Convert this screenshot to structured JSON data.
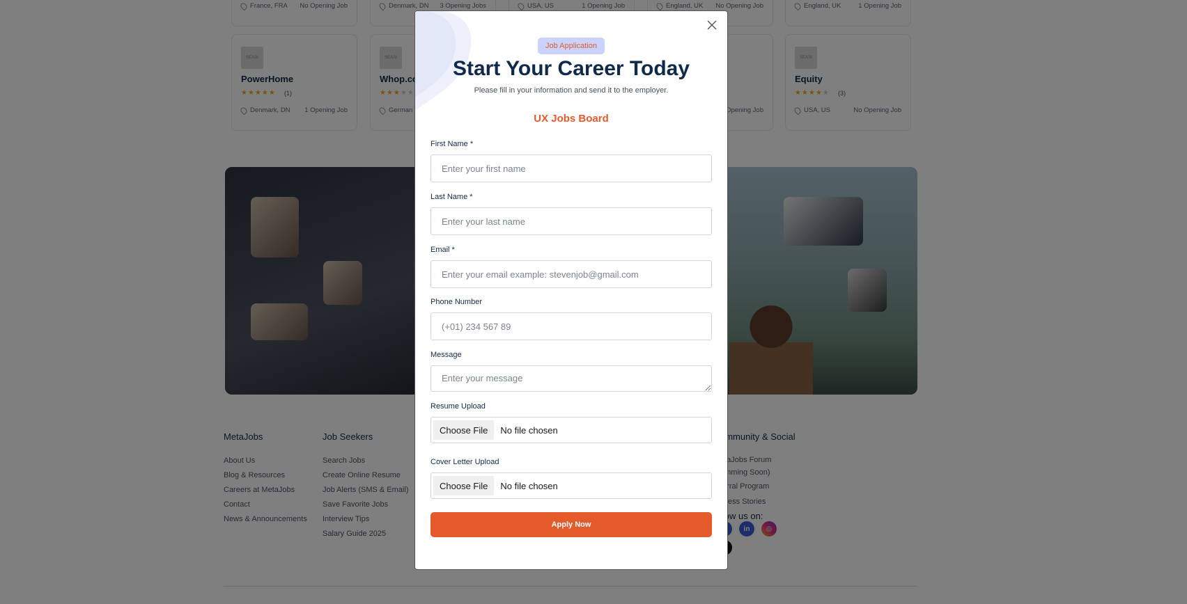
{
  "top_cards": [
    {
      "location": "France, FRA",
      "jobs": "No Opening Job"
    },
    {
      "location": "Denmark, DN",
      "jobs": "3 Opening Jobs"
    },
    {
      "location": "USA, US",
      "jobs": "1 Opening Job"
    },
    {
      "location": "England, UK",
      "jobs": "No Opening Job"
    },
    {
      "location": "England, UK",
      "jobs": "1 Opening Job"
    }
  ],
  "cards": [
    {
      "logo": "SEASI",
      "name": "PowerHome",
      "rating": 5,
      "count": "(1)",
      "location": "Denmark, DN",
      "jobs": "1 Opening Job"
    },
    {
      "logo": "SEASI",
      "name": "Whop.co",
      "rating": 3,
      "count": "",
      "location": "German",
      "jobs": ""
    },
    {
      "logo": "",
      "name": "",
      "rating": 0,
      "count": "",
      "location": "",
      "jobs": "No Opening Job"
    },
    {
      "logo": "SEASI",
      "name": "Equity",
      "rating": 4,
      "count": "(3)",
      "location": "USA, US",
      "jobs": "No Opening Job"
    }
  ],
  "footer": {
    "col1": {
      "title": "MetaJobs",
      "links": [
        "About Us",
        "Blog & Resources",
        "Careers at MetaJobs",
        "Contact",
        "News & Announcements"
      ]
    },
    "col2": {
      "title": "Job Seekers",
      "links": [
        "Search Jobs",
        "Create Online Resume",
        "Job Alerts (SMS & Email)",
        "Save Favorite Jobs",
        "Interview Tips",
        "Salary Guide 2025"
      ]
    },
    "col4": {
      "title": "ommunity & Social",
      "links": [
        "etaJobs Forum",
        "omming Soon)",
        "ferral Program",
        "ccess Stories"
      ],
      "follow": "llow us on:"
    }
  },
  "colors": {
    "accent": "#e55a2b",
    "navy": "#0f2a4a",
    "badge_bg": "#c9d3fb"
  },
  "modal": {
    "close_icon": "close-icon",
    "badge": "Job Application",
    "title": "Start Your Career Today",
    "subtitle": "Please fill in your information and send it to the employer.",
    "company": "UX Jobs Board",
    "fields": {
      "first_name": {
        "label": "First Name *",
        "placeholder": "Enter your first name",
        "value": ""
      },
      "last_name": {
        "label": "Last Name *",
        "placeholder": "Enter your last name",
        "value": ""
      },
      "email": {
        "label": "Email *",
        "placeholder": "Enter your email example: stevenjob@gmail.com",
        "value": ""
      },
      "phone": {
        "label": "Phone Number",
        "placeholder": "(+01) 234 567 89",
        "value": ""
      },
      "message": {
        "label": "Message",
        "placeholder": "Enter your message",
        "value": ""
      },
      "resume": {
        "label": "Resume Upload",
        "button": "Choose File",
        "status": "No file chosen"
      },
      "cover_letter": {
        "label": "Cover Letter Upload",
        "button": "Choose File",
        "status": "No file chosen"
      }
    },
    "submit": "Apply Now"
  }
}
